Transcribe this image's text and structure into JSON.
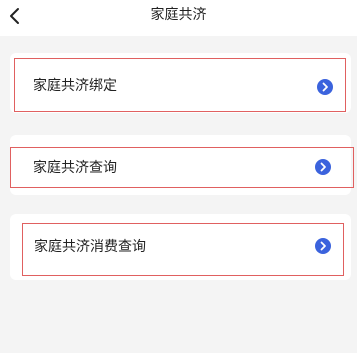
{
  "header": {
    "title": "家庭共济",
    "back_icon": "chevron-left-icon"
  },
  "menu": {
    "items": [
      {
        "label": "家庭共济绑定",
        "icon": "chevron-right-circle-icon"
      },
      {
        "label": "家庭共济查询",
        "icon": "chevron-right-circle-icon"
      },
      {
        "label": "家庭共济消费查询",
        "icon": "chevron-right-circle-icon"
      }
    ]
  },
  "colors": {
    "accent": "#3b63dd",
    "highlight_border": "#e06060",
    "background": "#f4f4f4"
  }
}
